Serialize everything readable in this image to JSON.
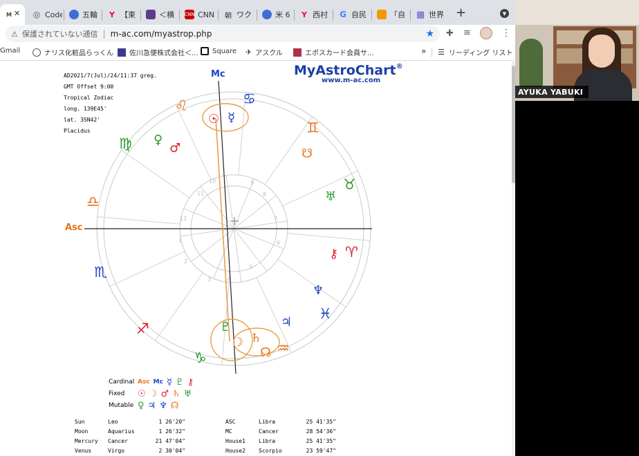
{
  "tabs": [
    {
      "label": "M",
      "favicon": "M",
      "color": "#7a7a7a",
      "active": true
    },
    {
      "label": "Code",
      "favicon": "◎",
      "color": "#555"
    },
    {
      "label": "五輪",
      "favicon": "●",
      "color": "#3b6fd6"
    },
    {
      "label": "【東",
      "favicon": "Y",
      "color": "#ff0033"
    },
    {
      "label": "＜横",
      "favicon": "■",
      "color": "#5b3b8c"
    },
    {
      "label": "CNN",
      "favicon": "C",
      "color": "#cc0000"
    },
    {
      "label": "ワク",
      "favicon": "ワ",
      "color": "#555"
    },
    {
      "label": "米 6",
      "favicon": "●",
      "color": "#3b6fd6"
    },
    {
      "label": "西村",
      "favicon": "Y",
      "color": "#ff0033"
    },
    {
      "label": "自民",
      "favicon": "G",
      "color": "#4285f4"
    },
    {
      "label": "「自",
      "favicon": "■",
      "color": "#f39800"
    },
    {
      "label": "世界",
      "favicon": "▦",
      "color": "#6a5acd"
    }
  ],
  "tab_close": "✕",
  "new_tab": "+",
  "address": {
    "security_text": "保護されていない通信",
    "url": "m-ac.com/myastrop.php"
  },
  "bookmarks": [
    {
      "label": "Gmail"
    },
    {
      "label": "ナリス化粧品らっくん"
    },
    {
      "label": "佐川急便株式会社＜..."
    },
    {
      "label": "Square"
    },
    {
      "label": "アスクル"
    },
    {
      "label": "エポスカード会員サ..."
    }
  ],
  "bookmarks_more": "»",
  "reading_list": "リーディング リスト",
  "chart_header": {
    "date": "AD2021/7(Jul)/24/11:37 greg.",
    "gmt": "GMT Offset 9:00",
    "zodiac": "Tropical Zodiac",
    "long": "long. 139E45'",
    "lat": "lat. 35N42'",
    "house_system": "Placidus"
  },
  "logo": {
    "title": "MyAstroChart",
    "reg": "®",
    "url": "www.m-ac.com"
  },
  "labels": {
    "mc": "Mc",
    "asc": "Asc"
  },
  "house_numbers": [
    "10",
    "11",
    "12",
    "1",
    "2",
    "3",
    "4",
    "5",
    "6",
    "7",
    "8",
    "9"
  ],
  "signs": [
    {
      "glyph": "♌",
      "color": "#e8731c"
    },
    {
      "glyph": "♋",
      "color": "#1a44c8"
    },
    {
      "glyph": "♊",
      "color": "#e8731c"
    },
    {
      "glyph": "♉",
      "color": "#2a9a2a"
    },
    {
      "glyph": "♈",
      "color": "#d8202a"
    },
    {
      "glyph": "♓",
      "color": "#1a44c8"
    },
    {
      "glyph": "♒",
      "color": "#e8731c"
    },
    {
      "glyph": "♑",
      "color": "#2a9a2a"
    },
    {
      "glyph": "♐",
      "color": "#d8202a"
    },
    {
      "glyph": "♏",
      "color": "#1a44c8"
    },
    {
      "glyph": "♎",
      "color": "#e8731c"
    },
    {
      "glyph": "♍",
      "color": "#2a9a2a"
    }
  ],
  "planets": [
    {
      "glyph": "☉",
      "color": "#d8202a"
    },
    {
      "glyph": "☿",
      "color": "#1a44c8"
    },
    {
      "glyph": "♀",
      "color": "#2a9a2a"
    },
    {
      "glyph": "♂",
      "color": "#d8202a"
    },
    {
      "glyph": "☋",
      "color": "#e8731c"
    },
    {
      "glyph": "♅",
      "color": "#2a9a2a"
    },
    {
      "glyph": "⚷",
      "color": "#d8202a"
    },
    {
      "glyph": "♆",
      "color": "#1a44c8"
    },
    {
      "glyph": "♃",
      "color": "#1a44c8"
    },
    {
      "glyph": "♇",
      "color": "#2a9a2a"
    },
    {
      "glyph": "☽",
      "color": "#e8731c"
    },
    {
      "glyph": "♄",
      "color": "#e8731c"
    },
    {
      "glyph": "☊",
      "color": "#e8731c"
    }
  ],
  "legend": {
    "rows": [
      {
        "label": "Cardinal",
        "glyphs": [
          {
            "g": "Asc",
            "c": "#e8731c"
          },
          {
            "g": "Mc",
            "c": "#1a44c8"
          },
          {
            "g": "☿",
            "c": "#1a44c8"
          },
          {
            "g": "♇",
            "c": "#2a9a2a"
          },
          {
            "g": "⚷",
            "c": "#d8202a"
          }
        ]
      },
      {
        "label": "Fixed",
        "glyphs": [
          {
            "g": "☉",
            "c": "#d8202a"
          },
          {
            "g": "☽",
            "c": "#e8731c"
          },
          {
            "g": "♂",
            "c": "#d8202a"
          },
          {
            "g": "♄",
            "c": "#e8731c"
          },
          {
            "g": "♅",
            "c": "#2a9a2a"
          }
        ]
      },
      {
        "label": "Mutable",
        "glyphs": [
          {
            "g": "♀",
            "c": "#2a9a2a"
          },
          {
            "g": "♃",
            "c": "#1a44c8"
          },
          {
            "g": "♆",
            "c": "#1a44c8"
          },
          {
            "g": "☊",
            "c": "#e8731c"
          }
        ]
      }
    ]
  },
  "positions_left": [
    {
      "body": "Sun",
      "sign": "Leo",
      "deg": "1 26'20\""
    },
    {
      "body": "Moon",
      "sign": "Aquarius",
      "deg": "1 26'32\""
    },
    {
      "body": "Mercury",
      "sign": "Cancer",
      "deg": "21 47'04\""
    },
    {
      "body": "Venus",
      "sign": "Virgo",
      "deg": "2 30'04\""
    }
  ],
  "positions_right": [
    {
      "body": "ASC",
      "sign": "Libra",
      "deg": "25 41'35\""
    },
    {
      "body": "MC",
      "sign": "Cancer",
      "deg": "28 54'36\""
    },
    {
      "body": "House1",
      "sign": "Libra",
      "deg": "25 41'35\""
    },
    {
      "body": "House2",
      "sign": "Scorpio",
      "deg": "23 59'47\""
    }
  ],
  "participant": {
    "name": "AYUKA YABUKI"
  }
}
